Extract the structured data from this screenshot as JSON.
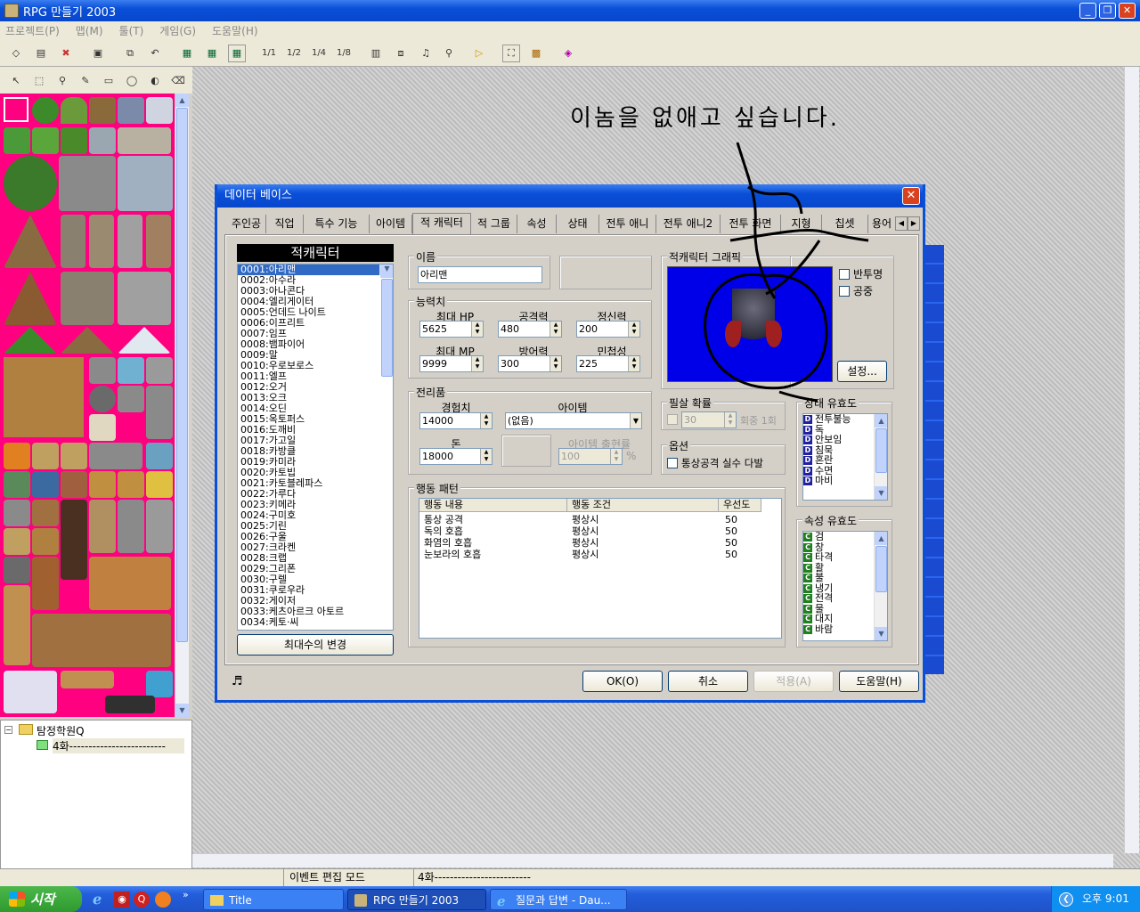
{
  "window": {
    "title": "RPG 만들기 2003",
    "minimize": "_",
    "maximize": "❐",
    "close": "✕"
  },
  "menu": [
    "프로젝트(P)",
    "맵(M)",
    "툴(T)",
    "게임(G)",
    "도움말(H)"
  ],
  "toolbar_scale_labels": [
    "1/1",
    "1/2",
    "1/4",
    "1/8"
  ],
  "annotation": {
    "text": "이놈을 없애고 싶습니다."
  },
  "tree": {
    "root": "탐정학원Q",
    "child": "4화-------------------------"
  },
  "statusbar": {
    "mode": "이벤트 편집 모드",
    "map": "4화-------------------------"
  },
  "taskbar": {
    "start": "시작",
    "tasks": [
      "Title",
      "RPG 만들기 2003",
      "질문과 답변 - Dau..."
    ],
    "clock": "오후 9:01"
  },
  "dialog": {
    "title": "데이터 베이스",
    "close": "✕",
    "tabs": [
      "주인공",
      "직업",
      "특수 기능",
      "아이템",
      "적 캐릭터",
      "적 그룹",
      "속성",
      "상태",
      "전투 애니",
      "전투 애니2",
      "전투 화면",
      "지형",
      "칩셋",
      "용어"
    ],
    "list_header": "적캐릭터",
    "enemies": [
      "0001:아리맨",
      "0002:아수라",
      "0003:아나콘다",
      "0004:엘리게이터",
      "0005:언데드 나이트",
      "0006:이프리트",
      "0007:임프",
      "0008:뱀파이어",
      "0009:말",
      "0010:우로보로스",
      "0011:엘프",
      "0012:오거",
      "0013:오크",
      "0014:오딘",
      "0015:옥토퍼스",
      "0016:도깨비",
      "0017:가고일",
      "0018:카방클",
      "0019:카미라",
      "0020:카토빕",
      "0021:카토블레파스",
      "0022:가루다",
      "0023:키메라",
      "0024:구미호",
      "0025:기린",
      "0026:구울",
      "0027:크라켄",
      "0028:크랩",
      "0029:그리폰",
      "0030:구렐",
      "0031:쿠로우라",
      "0032:게이저",
      "0033:케츠아르크 아토르",
      "0034:케토·씨"
    ],
    "max_button": "최대수의 변경",
    "name_label": "이름",
    "name_value": "아리맨",
    "stats_label": "능력치",
    "stats": [
      {
        "label": "최대 HP",
        "value": "5625"
      },
      {
        "label": "공격력",
        "value": "480"
      },
      {
        "label": "정신력",
        "value": "200"
      },
      {
        "label": "최대 MP",
        "value": "9999"
      },
      {
        "label": "방어력",
        "value": "300"
      },
      {
        "label": "민첩성",
        "value": "225"
      }
    ],
    "loot_label": "전리품",
    "exp_label": "경험치",
    "exp_value": "14000",
    "item_label": "아이템",
    "item_value": "(없음)",
    "gold_label": "돈",
    "gold_value": "18000",
    "droprate_label": "아이템 출현률",
    "droprate_value": "100",
    "droprate_unit": "%",
    "graphic_label": "적캐릭터 그래픽",
    "transparent_label": "반투명",
    "flying_label": "공중",
    "settings_button": "설정...",
    "crit_label": "필살 확률",
    "crit_value": "30",
    "crit_suffix": "회중 1회",
    "option_label": "옵션",
    "option_miss": "통상공격 실수 다발",
    "state_label": "상태 유효도",
    "states": [
      "전투불능",
      "독",
      "안보임",
      "침묵",
      "혼란",
      "수면",
      "마비"
    ],
    "attr_label": "속성 유효도",
    "attrs": [
      "검",
      "창",
      "타격",
      "활",
      "불",
      "냉기",
      "전격",
      "물",
      "대지",
      "바람"
    ],
    "action_label": "행동 패턴",
    "action_headers": [
      "행동 내용",
      "행동 조건",
      "우선도"
    ],
    "actions": [
      {
        "act": "통상 공격",
        "cond": "평상시",
        "prio": "50"
      },
      {
        "act": "독의 호흡",
        "cond": "평상시",
        "prio": "50"
      },
      {
        "act": "화염의 호흡",
        "cond": "평상시",
        "prio": "50"
      },
      {
        "act": "눈보라의 호흡",
        "cond": "평상시",
        "prio": "50"
      }
    ],
    "ok": "OK(O)",
    "cancel": "취소",
    "apply": "적용(A)",
    "help": "도움말(H)"
  }
}
